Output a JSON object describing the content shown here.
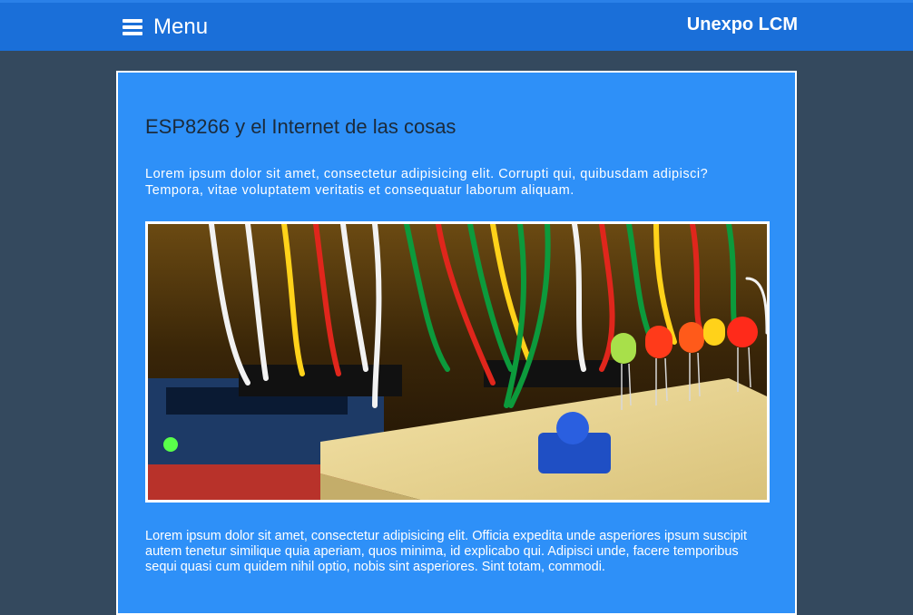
{
  "header": {
    "menu_label": "Menu",
    "brand": "Unexpo LCM"
  },
  "article": {
    "title": "ESP8266 y el Internet de las cosas",
    "intro": "Lorem ipsum dolor sit amet, consectetur adipisicing elit. Corrupti qui, quibusdam adipisci? Tempora, vitae voluptatem veritatis et consequatur laborum aliquam.",
    "body": "Lorem ipsum dolor sit amet, consectetur adipisicing elit. Officia expedita unde asperiores ipsum suscipit autem tenetur similique quia aperiam, quos minima, id explicabo qui. Adipisci unde, facere temporibus sequi quasi cum quidem nihil optio, nobis sint asperiores. Sint totam, commodi."
  },
  "colors": {
    "page_bg": "#34495e",
    "header_bg": "#1a6fd9",
    "card_bg": "#2e90f8"
  }
}
